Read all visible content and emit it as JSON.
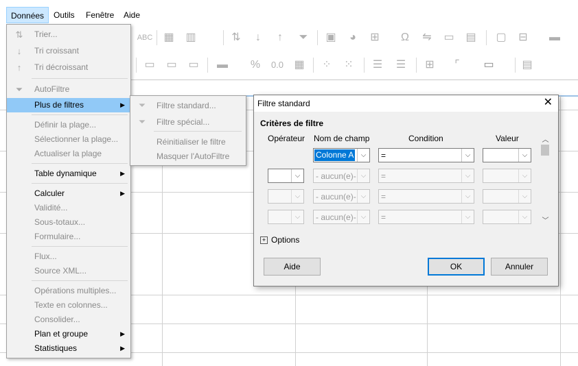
{
  "menubar": {
    "items": [
      {
        "label": "Données",
        "active": true
      },
      {
        "label": "Outils"
      },
      {
        "label": "Fenêtre"
      },
      {
        "label": "Aide"
      }
    ]
  },
  "toolbar": {
    "abc_label": "ABC",
    "percent": "%",
    "decimal": "0.0",
    "omega": "Ω"
  },
  "data_menu": {
    "items": [
      {
        "label": "Trier...",
        "icon": "sort-icon",
        "disabled": true
      },
      {
        "label": "Tri croissant",
        "icon": "sort-ascending-icon",
        "disabled": true
      },
      {
        "label": "Tri décroissant",
        "icon": "sort-descending-icon",
        "disabled": true
      },
      {
        "label": "AutoFiltre",
        "icon": "autofilter-icon",
        "disabled": true
      },
      {
        "label": "Plus de filtres",
        "highlight": true,
        "submenu": true
      },
      {
        "label": "Définir la plage...",
        "disabled": true
      },
      {
        "label": "Sélectionner la plage...",
        "disabled": true
      },
      {
        "label": "Actualiser la plage",
        "disabled": true
      },
      {
        "label": "Table dynamique",
        "submenu": true
      },
      {
        "label": "Calculer",
        "submenu": true
      },
      {
        "label": "Validité...",
        "disabled": true
      },
      {
        "label": "Sous-totaux...",
        "disabled": true
      },
      {
        "label": "Formulaire...",
        "disabled": true
      },
      {
        "label": "Flux...",
        "disabled": true
      },
      {
        "label": "Source XML...",
        "disabled": true
      },
      {
        "label": "Opérations multiples...",
        "disabled": true
      },
      {
        "label": "Texte en colonnes...",
        "disabled": true
      },
      {
        "label": "Consolider...",
        "disabled": true
      },
      {
        "label": "Plan et groupe",
        "submenu": true
      },
      {
        "label": "Statistiques",
        "submenu": true
      }
    ]
  },
  "filter_submenu": {
    "items": [
      {
        "label": "Filtre standard...",
        "icon": "standard-filter-icon",
        "disabled": true
      },
      {
        "label": "Filtre spécial...",
        "icon": "special-filter-icon",
        "disabled": true
      },
      {
        "label": "Réinitialiser le filtre",
        "disabled": true
      },
      {
        "label": "Masquer l'AutoFiltre",
        "disabled": true
      }
    ]
  },
  "dialog": {
    "title": "Filtre standard",
    "section_title": "Critères de filtre",
    "headers": {
      "operator": "Opérateur",
      "field_name": "Nom de champ",
      "condition": "Condition",
      "value": "Valeur"
    },
    "rows": [
      {
        "operator": "",
        "field": "Colonne A",
        "condition": "=",
        "value": "",
        "field_selected": true,
        "disabled": false
      },
      {
        "operator": "",
        "field": "- aucun(e)-",
        "condition": "=",
        "value": "",
        "disabled": true
      },
      {
        "operator": "",
        "field": "- aucun(e)-",
        "condition": "=",
        "value": "",
        "disabled": true
      },
      {
        "operator": "",
        "field": "- aucun(e)-",
        "condition": "=",
        "value": "",
        "disabled": true
      }
    ],
    "options_label": "Options",
    "buttons": {
      "help": "Aide",
      "ok": "OK",
      "cancel": "Annuler"
    }
  }
}
